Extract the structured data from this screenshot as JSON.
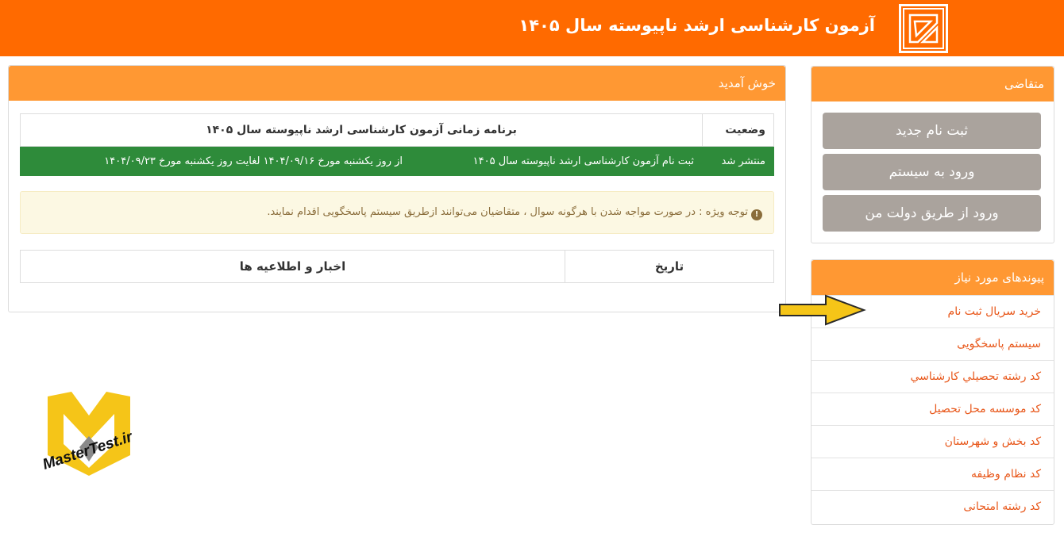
{
  "header": {
    "title": "آزمون کارشناسی ارشد ناپیوسته سال ۱۴۰۵",
    "bg_color": "#ff6a00"
  },
  "applicant_panel": {
    "title": "متقاضی",
    "buttons": [
      "ثبت نام جدید",
      "ورود به سیستم",
      "ورود از طریق دولت من"
    ]
  },
  "links_panel": {
    "title": "پیوندهای مورد نیاز",
    "items": [
      "خرید سریال ثبت نام",
      "سیستم پاسخگویی",
      "کد رشته تحصيلي كارشناسي",
      "کد موسسه محل تحصیل",
      "کد بخش و شهرستان",
      "کد نظام وظیفه",
      "کد رشته امتحانی"
    ]
  },
  "main_panel": {
    "title": "خوش آمدید",
    "status_label": "وضعیت",
    "status_value": "برنامه زمانی آزمون کارشناسی ارشد ناپیوسته سال ۱۴۰۵",
    "published_label": "منتشر شد",
    "published_item": "ثبت نام آزمون کارشناسی ارشد ناپیوسته سال ۱۴۰۵",
    "published_dates": "از روز یکشنبه مورخ ۱۴۰۴/۰۹/۱۶ لغایت روز یکشنبه مورخ ۱۴۰۴/۰۹/۲۳",
    "notice": "توجه ویژه : در صورت مواجه شدن با هرگونه سوال ، متقاضیان می‌توانند ازطریق سیستم پاسخگویی اقدام نمایند.",
    "news_date_header": "تاریخ",
    "news_header": "اخبار و اطلاعیه ها"
  },
  "watermark": {
    "text": "MasterTest.ir"
  },
  "colors": {
    "accent": "#ff9833",
    "button": "#aaa39d",
    "published": "#2e8b3a",
    "link": "#e8571a",
    "notice_bg": "#fcf8e3"
  }
}
